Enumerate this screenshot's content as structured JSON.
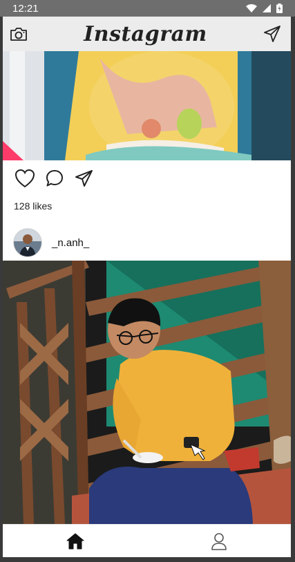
{
  "status": {
    "time": "12:21"
  },
  "app": {
    "title": "Instagram"
  },
  "icons": {
    "camera": "camera-icon",
    "send": "paper-plane-icon",
    "like": "heart-icon",
    "comment": "comment-icon",
    "share": "paper-plane-icon",
    "home": "home-icon",
    "profile": "profile-icon"
  },
  "post1": {
    "likes": "128 likes"
  },
  "post2": {
    "username": "_n.anh_"
  },
  "colors": {
    "accent": "#222222",
    "statusbar": "#6e6e6e",
    "topbar": "#ececec"
  }
}
